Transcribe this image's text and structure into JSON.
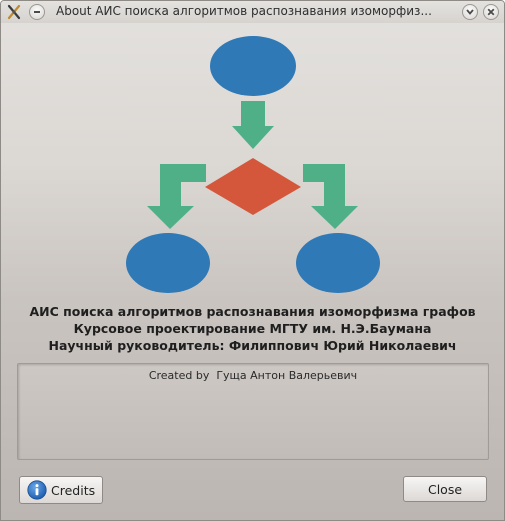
{
  "window": {
    "title": "About АИС поиска алгоритмов распознавания изоморфиз..."
  },
  "about": {
    "line1": "АИС поиска алгоритмов распознавания изоморфизма графов",
    "line2": "Курсовое проектирование МГТУ им. Н.Э.Баумана",
    "line3": "Научный руководитель: Филиппович Юрий Николаевич"
  },
  "credits_box": {
    "text": "Created by  Гуща Антон Валерьевич"
  },
  "buttons": {
    "credits_label": "Credits",
    "close_label": "Close"
  },
  "icons": {
    "app": "app-icon",
    "minimize": "minimize-icon",
    "shade": "shade-icon",
    "close": "close-icon",
    "info": "info-icon"
  },
  "colors": {
    "flow_ellipse": "#2f79b6",
    "flow_diamond": "#d4573c",
    "flow_arrow": "#4fb088"
  }
}
